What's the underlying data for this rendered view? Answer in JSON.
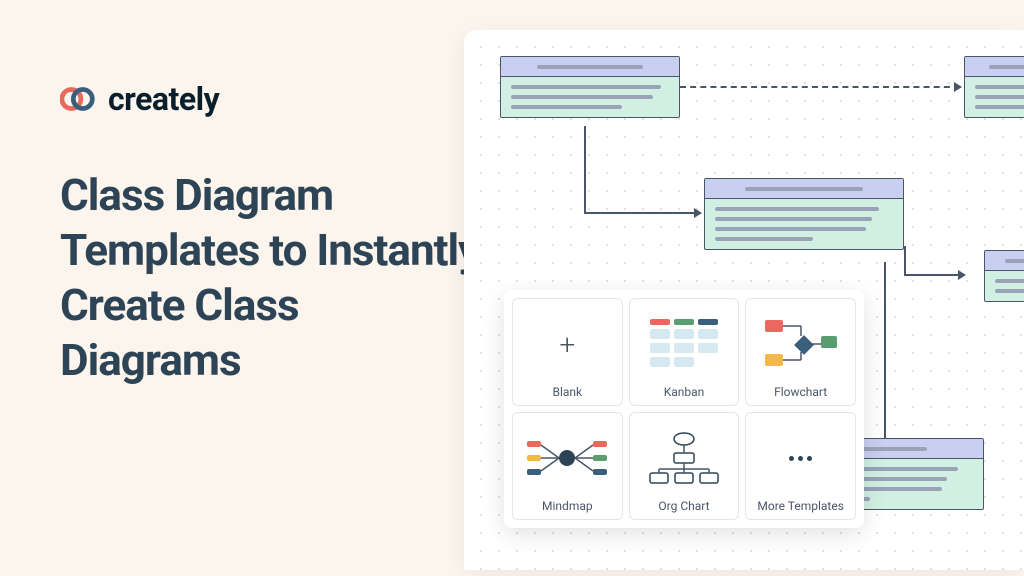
{
  "brand": {
    "name": "creately"
  },
  "headline": "Class Diagram Templates to Instantly Create Class Diagrams",
  "template_picker": {
    "tiles": [
      {
        "label": "Blank"
      },
      {
        "label": "Kanban"
      },
      {
        "label": "Flowchart"
      },
      {
        "label": "Mindmap"
      },
      {
        "label": "Org Chart"
      },
      {
        "label": "More Templates"
      }
    ]
  }
}
